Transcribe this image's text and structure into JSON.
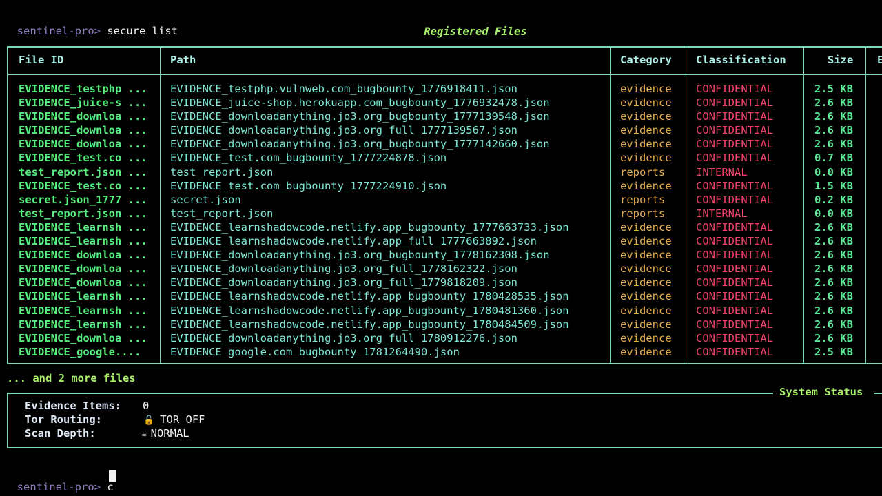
{
  "terminal": {
    "prompt": "sentinel-pro>",
    "first_command": "secure list",
    "current_input": "c"
  },
  "table": {
    "title": "Registered Files",
    "columns": [
      "File ID",
      "Path",
      "Category",
      "Classification",
      "Size",
      "E"
    ],
    "rows": [
      {
        "id": "EVIDENCE_testphp ...",
        "path": "EVIDENCE_testphp.vulnweb.com_bugbounty_1776918411.json",
        "category": "evidence",
        "classification": "CONFIDENTIAL",
        "size": "2.5 KB"
      },
      {
        "id": "EVIDENCE_juice-s ...",
        "path": "EVIDENCE_juice-shop.herokuapp.com_bugbounty_1776932478.json",
        "category": "evidence",
        "classification": "CONFIDENTIAL",
        "size": "2.6 KB"
      },
      {
        "id": "EVIDENCE_downloa ...",
        "path": "EVIDENCE_downloadanything.jo3.org_bugbounty_1777139548.json",
        "category": "evidence",
        "classification": "CONFIDENTIAL",
        "size": "2.6 KB"
      },
      {
        "id": "EVIDENCE_downloa ...",
        "path": "EVIDENCE_downloadanything.jo3.org_full_1777139567.json",
        "category": "evidence",
        "classification": "CONFIDENTIAL",
        "size": "2.6 KB"
      },
      {
        "id": "EVIDENCE_downloa ...",
        "path": "EVIDENCE_downloadanything.jo3.org_bugbounty_1777142660.json",
        "category": "evidence",
        "classification": "CONFIDENTIAL",
        "size": "2.6 KB"
      },
      {
        "id": "EVIDENCE_test.co ...",
        "path": "EVIDENCE_test.com_bugbounty_1777224878.json",
        "category": "evidence",
        "classification": "CONFIDENTIAL",
        "size": "0.7 KB"
      },
      {
        "id": "test_report.json ...",
        "path": "test_report.json",
        "category": "reports",
        "classification": "INTERNAL",
        "size": "0.0 KB"
      },
      {
        "id": "EVIDENCE_test.co ...",
        "path": "EVIDENCE_test.com_bugbounty_1777224910.json",
        "category": "evidence",
        "classification": "CONFIDENTIAL",
        "size": "1.5 KB"
      },
      {
        "id": "secret.json_1777 ...",
        "path": "secret.json",
        "category": "reports",
        "classification": "CONFIDENTIAL",
        "size": "0.2 KB"
      },
      {
        "id": "test_report.json ...",
        "path": "test_report.json",
        "category": "reports",
        "classification": "INTERNAL",
        "size": "0.0 KB"
      },
      {
        "id": "EVIDENCE_learnsh ...",
        "path": "EVIDENCE_learnshadowcode.netlify.app_bugbounty_1777663733.json",
        "category": "evidence",
        "classification": "CONFIDENTIAL",
        "size": "2.6 KB"
      },
      {
        "id": "EVIDENCE_learnsh ...",
        "path": "EVIDENCE_learnshadowcode.netlify.app_full_1777663892.json",
        "category": "evidence",
        "classification": "CONFIDENTIAL",
        "size": "2.6 KB"
      },
      {
        "id": "EVIDENCE_downloa ...",
        "path": "EVIDENCE_downloadanything.jo3.org_bugbounty_1778162308.json",
        "category": "evidence",
        "classification": "CONFIDENTIAL",
        "size": "2.6 KB"
      },
      {
        "id": "EVIDENCE_downloa ...",
        "path": "EVIDENCE_downloadanything.jo3.org_full_1778162322.json",
        "category": "evidence",
        "classification": "CONFIDENTIAL",
        "size": "2.6 KB"
      },
      {
        "id": "EVIDENCE_downloa ...",
        "path": "EVIDENCE_downloadanything.jo3.org_full_1779818209.json",
        "category": "evidence",
        "classification": "CONFIDENTIAL",
        "size": "2.6 KB"
      },
      {
        "id": "EVIDENCE_learnsh ...",
        "path": "EVIDENCE_learnshadowcode.netlify.app_bugbounty_1780428535.json",
        "category": "evidence",
        "classification": "CONFIDENTIAL",
        "size": "2.6 KB"
      },
      {
        "id": "EVIDENCE_learnsh ...",
        "path": "EVIDENCE_learnshadowcode.netlify.app_bugbounty_1780481360.json",
        "category": "evidence",
        "classification": "CONFIDENTIAL",
        "size": "2.6 KB"
      },
      {
        "id": "EVIDENCE_learnsh ...",
        "path": "EVIDENCE_learnshadowcode.netlify.app_bugbounty_1780484509.json",
        "category": "evidence",
        "classification": "CONFIDENTIAL",
        "size": "2.6 KB"
      },
      {
        "id": "EVIDENCE_downloa ...",
        "path": "EVIDENCE_downloadanything.jo3.org_full_1780912276.json",
        "category": "evidence",
        "classification": "CONFIDENTIAL",
        "size": "2.6 KB"
      },
      {
        "id": "EVIDENCE_google....",
        "path": "EVIDENCE_google.com_bugbounty_1781264490.json",
        "category": "evidence",
        "classification": "CONFIDENTIAL",
        "size": "2.5 KB"
      }
    ],
    "more_files": "... and 2 more files"
  },
  "status": {
    "title": "System Status",
    "evidence_label": "Evidence Items:",
    "evidence_value": "0",
    "tor_label": "Tor Routing:",
    "tor_value": "TOR OFF",
    "tor_icon": "lock-icon",
    "depth_label": "Scan Depth:",
    "depth_value": "NORMAL",
    "depth_icon": "depth-icon"
  },
  "colors": {
    "background": "#000000",
    "border": "#7fd8b8",
    "accent_green": "#a8ef6a",
    "prompt": "#8e7cc3",
    "confidential": "#f0436a",
    "category": "#e2aa50"
  }
}
